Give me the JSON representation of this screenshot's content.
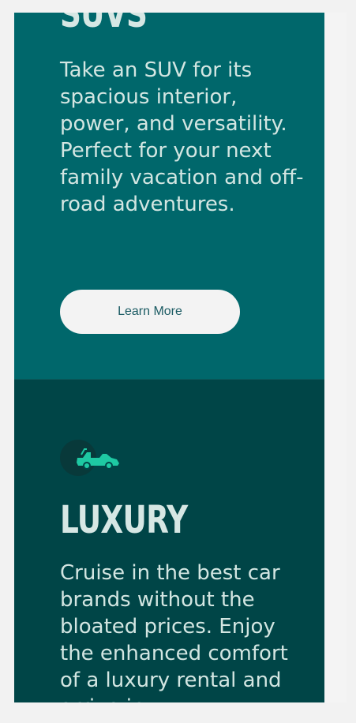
{
  "suv_card": {
    "title": "SUVS",
    "description": "Take an SUV for its spacious interior, power, and versatility. Perfect for your next family vacation and off-road adventures.",
    "button_label": "Learn More"
  },
  "luxury_card": {
    "title": "LUXURY",
    "icon": "convertible-car-icon",
    "description": "Cruise in the best car brands without the bloated prices. Enjoy the enhanced comfort of a luxury rental and arrive in"
  },
  "colors": {
    "suv_panel": "#00676b",
    "luxury_panel": "#004547",
    "icon_accent": "#1ec9a3",
    "button_bg": "#f3f3f3",
    "button_text": "#1b5b63"
  }
}
